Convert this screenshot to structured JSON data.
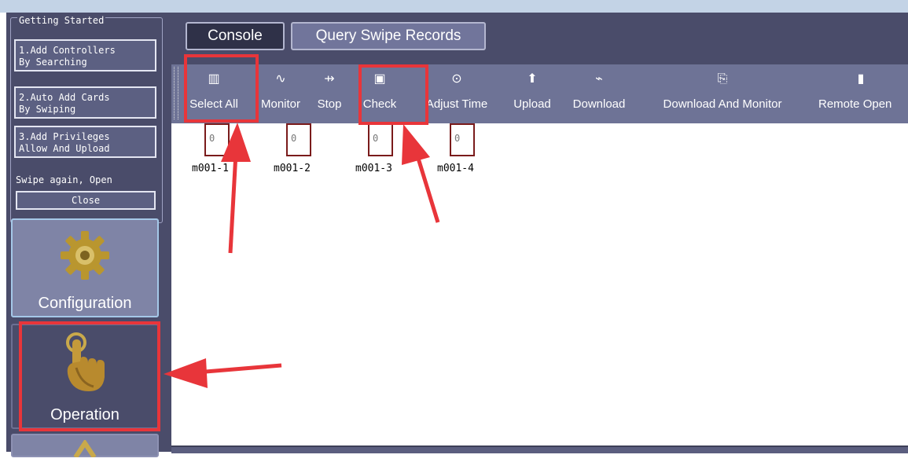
{
  "getting_started": {
    "title": "Getting Started",
    "steps": [
      {
        "label": "1.Add Controllers\nBy Searching"
      },
      {
        "label": "2.Auto Add Cards\nBy Swiping"
      },
      {
        "label": "3.Add Privileges\nAllow And Upload"
      }
    ],
    "swipe_text": "Swipe again, Open",
    "close_label": "Close"
  },
  "nav": {
    "configuration": {
      "label": "Configuration",
      "icon": "gear-icon"
    },
    "operation": {
      "label": "Operation",
      "icon": "hand-pointer-icon"
    }
  },
  "tabs": {
    "console": "Console",
    "query": "Query Swipe Records"
  },
  "toolbar": [
    {
      "label": "Select All",
      "icon": "select-all-icon",
      "glyph": "▥"
    },
    {
      "label": "Monitor",
      "icon": "monitor-icon",
      "glyph": "∿"
    },
    {
      "label": "Stop",
      "icon": "stop-icon",
      "glyph": "⇸"
    },
    {
      "label": "Check",
      "icon": "check-icon",
      "glyph": "▣"
    },
    {
      "label": "Adjust Time",
      "icon": "clock-icon",
      "glyph": "⊙"
    },
    {
      "label": "Upload",
      "icon": "upload-arrow-icon",
      "glyph": "⬆"
    },
    {
      "label": "Download",
      "icon": "download-icon",
      "glyph": "⌁"
    },
    {
      "label": "Download And Monitor",
      "icon": "download-monitor-icon",
      "glyph": "⎘"
    },
    {
      "label": "Remote Open",
      "icon": "door-open-icon",
      "glyph": "▮"
    }
  ],
  "doors": [
    {
      "name": "m001-1",
      "value": "0"
    },
    {
      "name": "m001-2",
      "value": "0"
    },
    {
      "name": "m001-3",
      "value": "0"
    },
    {
      "name": "m001-4",
      "value": "0"
    }
  ],
  "colors": {
    "panel_bg": "#4a4c6a",
    "toolbar_bg": "#6e7396",
    "highlight_red": "#e8353a",
    "door_border": "#7a1b1b"
  }
}
